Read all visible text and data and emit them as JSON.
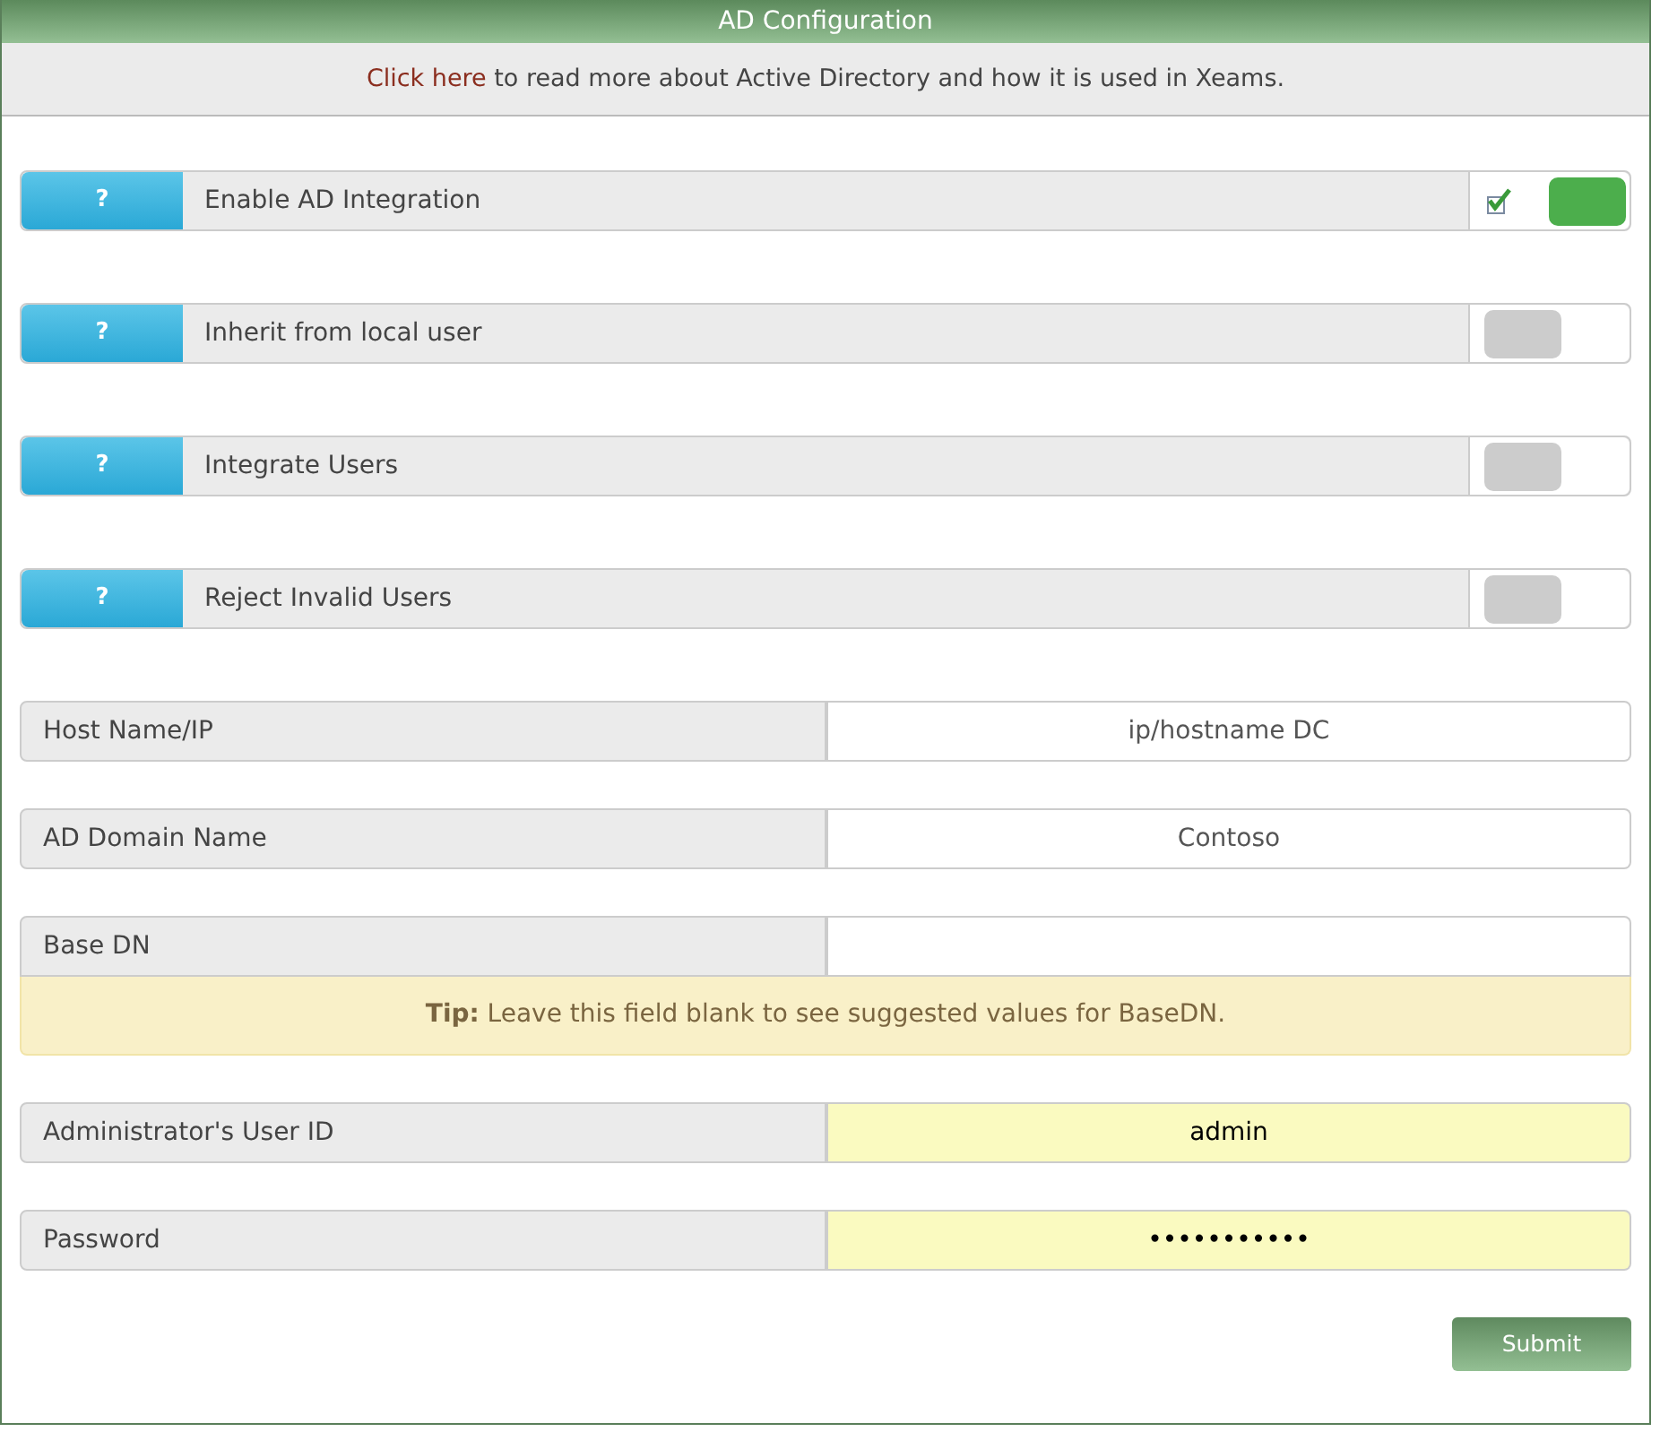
{
  "panel": {
    "title": "AD Configuration"
  },
  "info": {
    "link": "Click here",
    "text": " to read more about Active Directory and how it is used in Xeams."
  },
  "toggles": [
    {
      "help": "?",
      "label": "Enable AD Integration",
      "on": true
    },
    {
      "help": "?",
      "label": "Inherit from local user",
      "on": false
    },
    {
      "help": "?",
      "label": "Integrate Users",
      "on": false
    },
    {
      "help": "?",
      "label": "Reject Invalid Users",
      "on": false
    }
  ],
  "fields": [
    {
      "label": "Host Name/IP",
      "value": "ip/hostname DC",
      "autofilled": false
    },
    {
      "label": "AD Domain Name",
      "value": "Contoso",
      "autofilled": false
    },
    {
      "label": "Base DN",
      "autofilled": false,
      "tip": "**Tip:** Leave this field blank to see suggested values for BaseDN."
    },
    {
      "label": "Administrator's User ID",
      "value": "admin",
      "autofilled": true
    },
    {
      "label": "Password",
      "value": "•••••••••••",
      "autofilled": true
    }
  ],
  "submit": "Submit"
}
